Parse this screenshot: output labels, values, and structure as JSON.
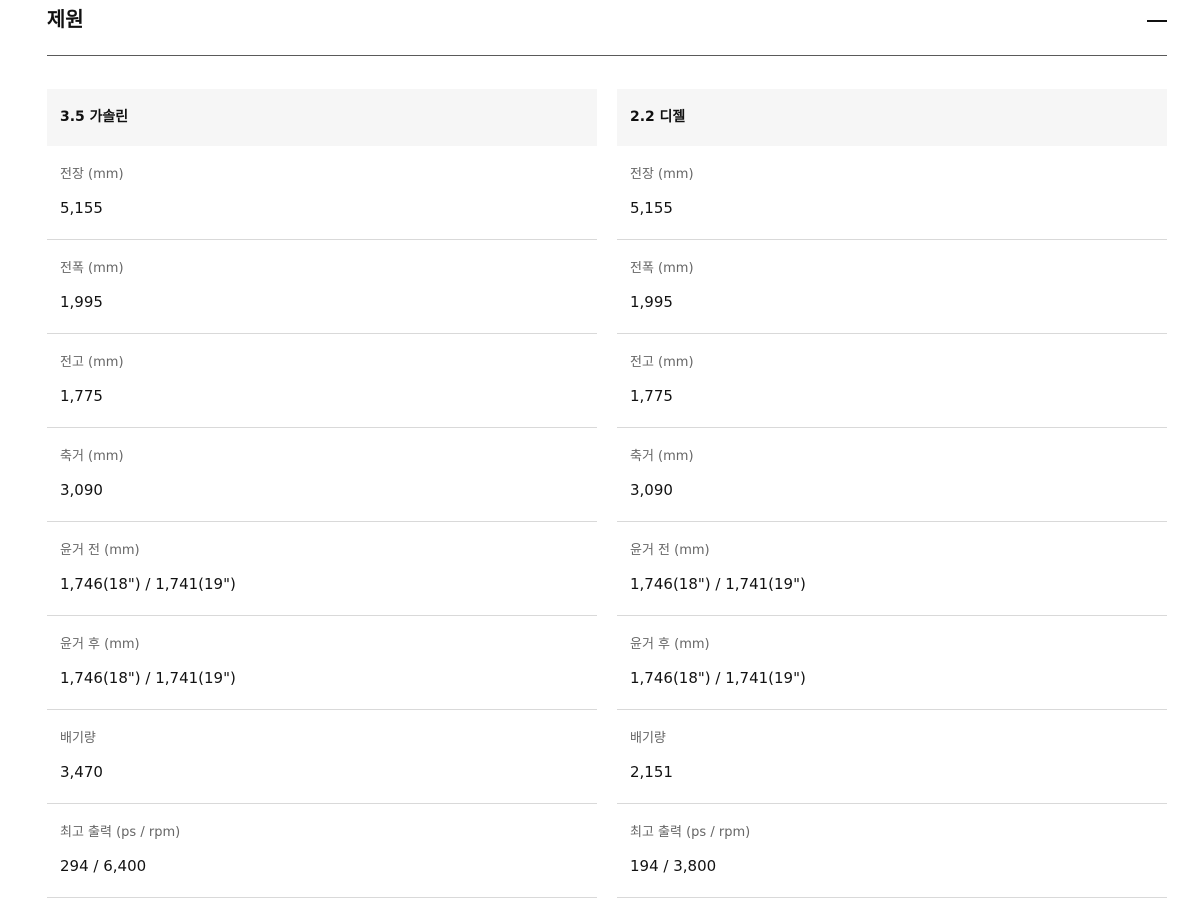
{
  "section": {
    "title": "제원",
    "collapse_icon": "minus-icon"
  },
  "columns": [
    {
      "header": "3.5 가솔린",
      "rows": [
        {
          "label": "전장 (mm)",
          "value": "5,155"
        },
        {
          "label": "전폭 (mm)",
          "value": "1,995"
        },
        {
          "label": "전고 (mm)",
          "value": "1,775"
        },
        {
          "label": "축거 (mm)",
          "value": "3,090"
        },
        {
          "label": "윤거 전 (mm)",
          "value": "1,746(18\") / 1,741(19\")"
        },
        {
          "label": "윤거 후 (mm)",
          "value": "1,746(18\") / 1,741(19\")"
        },
        {
          "label": "배기량",
          "value": "3,470"
        },
        {
          "label": "최고 출력 (ps / rpm)",
          "value": "294 / 6,400"
        }
      ]
    },
    {
      "header": "2.2 디젤",
      "rows": [
        {
          "label": "전장 (mm)",
          "value": "5,155"
        },
        {
          "label": "전폭 (mm)",
          "value": "1,995"
        },
        {
          "label": "전고 (mm)",
          "value": "1,775"
        },
        {
          "label": "축거 (mm)",
          "value": "3,090"
        },
        {
          "label": "윤거 전 (mm)",
          "value": "1,746(18\") / 1,741(19\")"
        },
        {
          "label": "윤거 후 (mm)",
          "value": "1,746(18\") / 1,741(19\")"
        },
        {
          "label": "배기량",
          "value": "2,151"
        },
        {
          "label": "최고 출력 (ps / rpm)",
          "value": "194 / 3,800"
        }
      ]
    }
  ]
}
